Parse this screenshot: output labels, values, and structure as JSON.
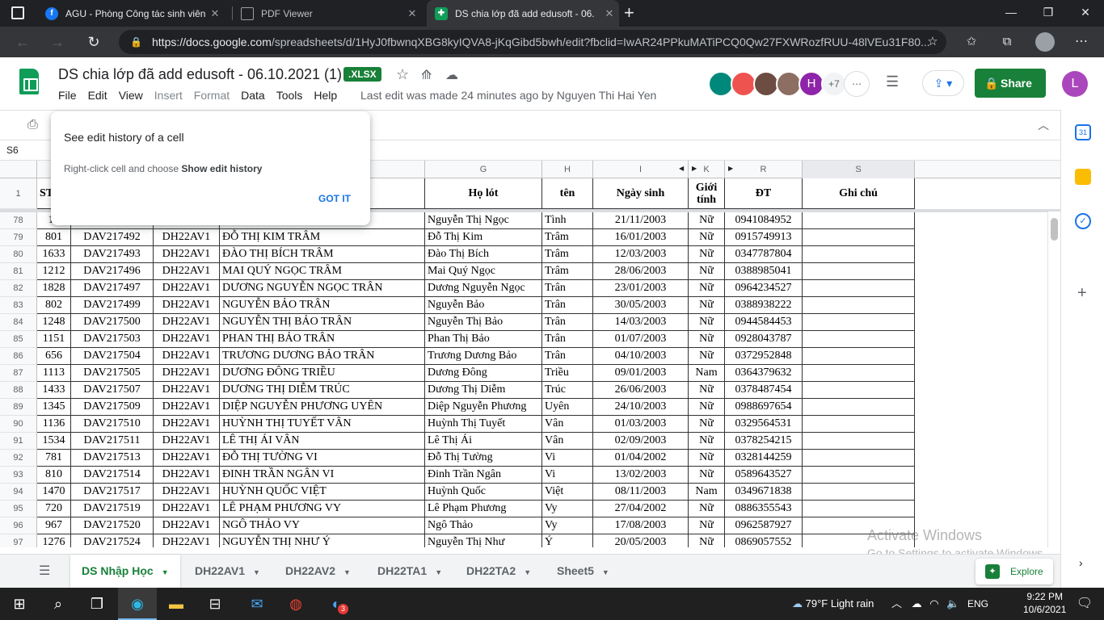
{
  "browser": {
    "tabs": [
      {
        "title": "AGU - Phòng Công tác sinh viên",
        "icon": "facebook-icon",
        "color": "#1877f2"
      },
      {
        "title": "PDF Viewer",
        "icon": "pdf-icon",
        "color": "#5f6368"
      },
      {
        "title": "DS chia lớp đã add edusoft - 06.",
        "icon": "sheets-icon",
        "color": "#0f9d58"
      }
    ],
    "url_host": "https://docs.google.com",
    "url_path": "/spreadsheets/d/1HyJ0fbwnqXBG8kyIQVA8-jKqGibd5bwh/edit?fbclid=IwAR24PPkuMATiPCQ0Qw27FXWRozfRUU-48lVEu31F80..."
  },
  "doc": {
    "title": "DS chia lớp đã add edusoft - 06.10.2021 (1)",
    "badge": ".XLSX",
    "menu": [
      "File",
      "Edit",
      "View",
      "Insert",
      "Format",
      "Data",
      "Tools",
      "Help"
    ],
    "last_edit": "Last edit was made 24 minutes ago by Nguyen Thi Hai Yen",
    "collab_extra": "+7",
    "collab_letter": "H",
    "share": "Share",
    "user_initial": "L"
  },
  "namebox": "S6",
  "popup": {
    "title": "See edit history of a cell",
    "body_prefix": "Right-click cell and choose ",
    "body_bold": "Show edit history",
    "button": "GOT IT"
  },
  "grid": {
    "col_letters": {
      "G": "G",
      "H": "H",
      "I": "I",
      "K": "K",
      "R": "R",
      "S": "S"
    },
    "header_row_number": "1",
    "headers": {
      "stt": "ST",
      "holot": "Họ lót",
      "ten": "tên",
      "ngaysinh": "Ngày sinh",
      "gioitinh": "Giới tính",
      "dt": "ĐT",
      "ghichu": "Ghi chú"
    },
    "rows": [
      {
        "n": "78",
        "stt": "16",
        "msv": "",
        "lop": "",
        "hoten": "",
        "holot": "Nguyễn Thị Ngọc",
        "ten": "Tình",
        "ns": "21/11/2003",
        "gt": "Nữ",
        "dt": "0941084952"
      },
      {
        "n": "79",
        "stt": "801",
        "msv": "DAV217492",
        "lop": "DH22AV1",
        "hoten": "ĐỖ THỊ KIM TRÂM",
        "holot": "Đỗ Thị Kim",
        "ten": "Trâm",
        "ns": "16/01/2003",
        "gt": "Nữ",
        "dt": "0915749913"
      },
      {
        "n": "80",
        "stt": "1633",
        "msv": "DAV217493",
        "lop": "DH22AV1",
        "hoten": "ĐÀO THỊ BÍCH TRÂM",
        "holot": "Đào Thị Bích",
        "ten": "Trâm",
        "ns": "12/03/2003",
        "gt": "Nữ",
        "dt": "0347787804"
      },
      {
        "n": "81",
        "stt": "1212",
        "msv": "DAV217496",
        "lop": "DH22AV1",
        "hoten": "MAI QUÝ NGỌC TRÂM",
        "holot": "Mai Quý Ngọc",
        "ten": "Trâm",
        "ns": "28/06/2003",
        "gt": "Nữ",
        "dt": "0388985041"
      },
      {
        "n": "82",
        "stt": "1828",
        "msv": "DAV217497",
        "lop": "DH22AV1",
        "hoten": "DƯƠNG NGUYỄN NGỌC TRÂN",
        "holot": "Dương Nguyễn Ngọc",
        "ten": "Trân",
        "ns": "23/01/2003",
        "gt": "Nữ",
        "dt": "0964234527"
      },
      {
        "n": "83",
        "stt": "802",
        "msv": "DAV217499",
        "lop": "DH22AV1",
        "hoten": "NGUYỄN BẢO TRÂN",
        "holot": "Nguyễn Bảo",
        "ten": "Trân",
        "ns": "30/05/2003",
        "gt": "Nữ",
        "dt": "0388938222"
      },
      {
        "n": "84",
        "stt": "1248",
        "msv": "DAV217500",
        "lop": "DH22AV1",
        "hoten": "NGUYỄN THỊ BẢO TRÂN",
        "holot": "Nguyễn Thị Bảo",
        "ten": "Trân",
        "ns": "14/03/2003",
        "gt": "Nữ",
        "dt": "0944584453"
      },
      {
        "n": "85",
        "stt": "1151",
        "msv": "DAV217503",
        "lop": "DH22AV1",
        "hoten": "PHAN THỊ BẢO TRÂN",
        "holot": "Phan Thị Bảo",
        "ten": "Trân",
        "ns": "01/07/2003",
        "gt": "Nữ",
        "dt": "0928043787"
      },
      {
        "n": "86",
        "stt": "656",
        "msv": "DAV217504",
        "lop": "DH22AV1",
        "hoten": "TRƯƠNG DƯƠNG BẢO TRÂN",
        "holot": "Trương Dương Bảo",
        "ten": "Trân",
        "ns": "04/10/2003",
        "gt": "Nữ",
        "dt": "0372952848"
      },
      {
        "n": "87",
        "stt": "1113",
        "msv": "DAV217505",
        "lop": "DH22AV1",
        "hoten": "DƯƠNG ĐÔNG TRIỀU",
        "holot": "Dương Đông",
        "ten": "Triều",
        "ns": "09/01/2003",
        "gt": "Nam",
        "dt": "0364379632"
      },
      {
        "n": "88",
        "stt": "1433",
        "msv": "DAV217507",
        "lop": "DH22AV1",
        "hoten": "DƯƠNG THỊ DIỄM TRÚC",
        "holot": "Dương Thị Diễm",
        "ten": "Trúc",
        "ns": "26/06/2003",
        "gt": "Nữ",
        "dt": "0378487454"
      },
      {
        "n": "89",
        "stt": "1345",
        "msv": "DAV217509",
        "lop": "DH22AV1",
        "hoten": "DIỆP NGUYỄN PHƯƠNG UYÊN",
        "holot": "Diệp Nguyễn Phương",
        "ten": "Uyên",
        "ns": "24/10/2003",
        "gt": "Nữ",
        "dt": "0988697654"
      },
      {
        "n": "90",
        "stt": "1136",
        "msv": "DAV217510",
        "lop": "DH22AV1",
        "hoten": "HUỲNH THỊ TUYẾT VÂN",
        "holot": "Huỳnh Thị Tuyết",
        "ten": "Vân",
        "ns": "01/03/2003",
        "gt": "Nữ",
        "dt": "0329564531"
      },
      {
        "n": "91",
        "stt": "1534",
        "msv": "DAV217511",
        "lop": "DH22AV1",
        "hoten": "LÊ THỊ ÁI VÂN",
        "holot": "Lê Thị Ái",
        "ten": "Vân",
        "ns": "02/09/2003",
        "gt": "Nữ",
        "dt": "0378254215"
      },
      {
        "n": "92",
        "stt": "781",
        "msv": "DAV217513",
        "lop": "DH22AV1",
        "hoten": "ĐỖ THỊ TƯỜNG VI",
        "holot": "Đỗ Thị Tường",
        "ten": "Vi",
        "ns": "01/04/2002",
        "gt": "Nữ",
        "dt": "0328144259"
      },
      {
        "n": "93",
        "stt": "810",
        "msv": "DAV217514",
        "lop": "DH22AV1",
        "hoten": "ĐINH TRẦN NGÂN VI",
        "holot": "Đinh Trần Ngân",
        "ten": "Vi",
        "ns": "13/02/2003",
        "gt": "Nữ",
        "dt": "0589643527"
      },
      {
        "n": "94",
        "stt": "1470",
        "msv": "DAV217517",
        "lop": "DH22AV1",
        "hoten": "HUỲNH QUỐC VIỆT",
        "holot": "Huỳnh Quốc",
        "ten": "Việt",
        "ns": "08/11/2003",
        "gt": "Nam",
        "dt": "0349671838"
      },
      {
        "n": "95",
        "stt": "720",
        "msv": "DAV217519",
        "lop": "DH22AV1",
        "hoten": "LÊ PHẠM PHƯƠNG VY",
        "holot": "Lê Phạm Phương",
        "ten": "Vy",
        "ns": "27/04/2002",
        "gt": "Nữ",
        "dt": "0886355543"
      },
      {
        "n": "96",
        "stt": "967",
        "msv": "DAV217520",
        "lop": "DH22AV1",
        "hoten": "NGÔ THẢO VY",
        "holot": "Ngô Thảo",
        "ten": "Vy",
        "ns": "17/08/2003",
        "gt": "Nữ",
        "dt": "0962587927"
      },
      {
        "n": "97",
        "stt": "1276",
        "msv": "DAV217524",
        "lop": "DH22AV1",
        "hoten": "NGUYỄN THỊ NHƯ Ý",
        "holot": "Nguyễn Thị Như",
        "ten": "Ý",
        "ns": "20/05/2003",
        "gt": "Nữ",
        "dt": "0869057552"
      }
    ]
  },
  "sheet_tabs": [
    {
      "label": "DS Nhập Học",
      "active": true
    },
    {
      "label": "DH22AV1",
      "active": false
    },
    {
      "label": "DH22AV2",
      "active": false
    },
    {
      "label": "DH22TA1",
      "active": false
    },
    {
      "label": "DH22TA2",
      "active": false
    },
    {
      "label": "Sheet5",
      "active": false
    }
  ],
  "explore": "Explore",
  "watermark": {
    "line1": "Activate Windows",
    "line2": "Go to Settings to activate Windows."
  },
  "taskbar": {
    "weather": "79°F  Light rain",
    "lang": "ENG",
    "time": "9:22 PM",
    "date": "10/6/2021",
    "badge": "3"
  },
  "colors": {
    "sheets_green": "#188038",
    "accent_blue": "#1a73e8"
  }
}
